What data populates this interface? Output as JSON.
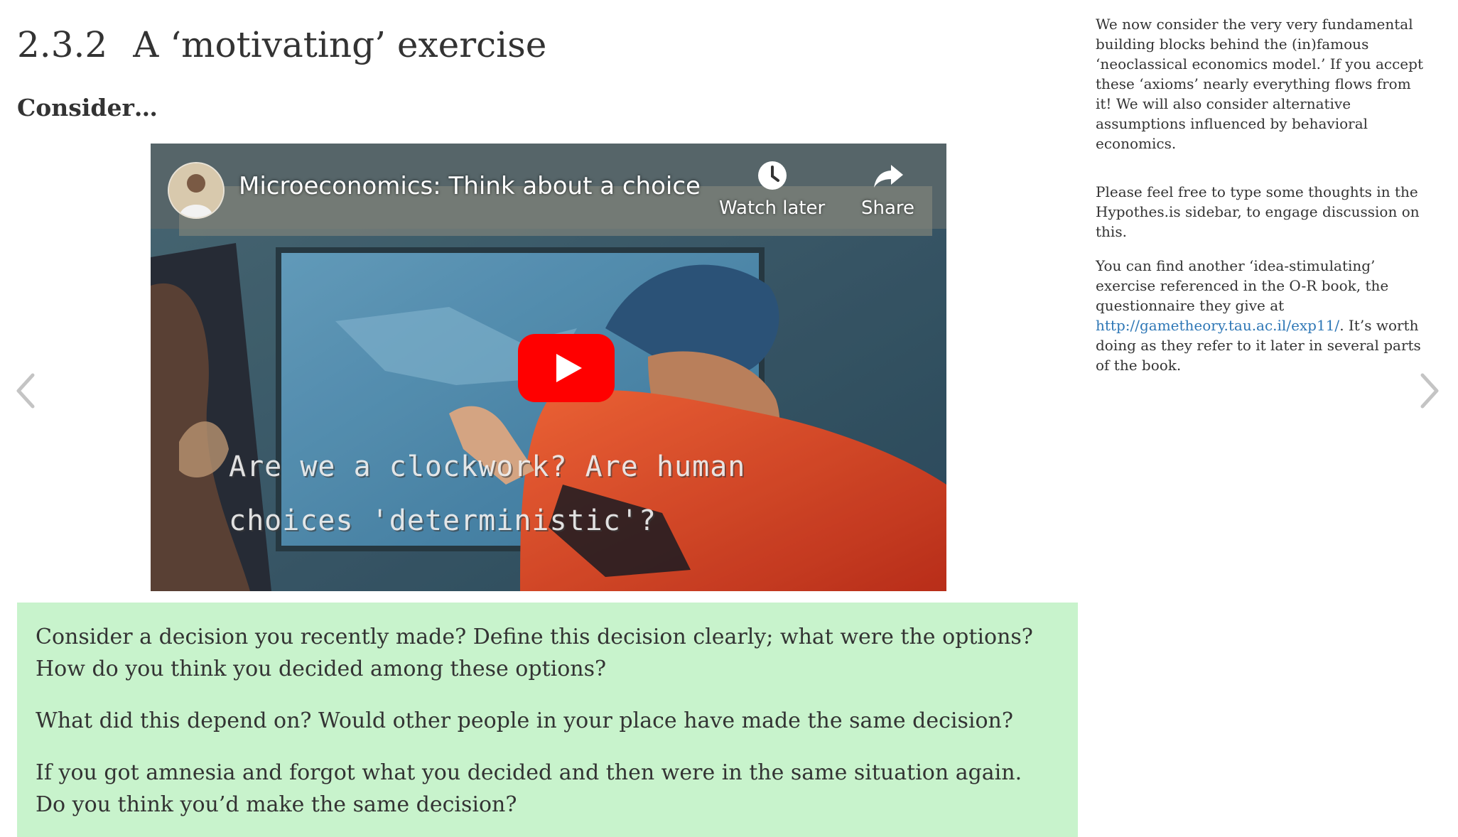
{
  "section": {
    "number": "2.3.2",
    "title": "A ‘motivating’ exercise"
  },
  "consider_heading": "Consider…",
  "video": {
    "title": "Microeconomics: Think about a choice",
    "watch_later_label": "Watch later",
    "share_label": "Share",
    "caption_line1": "Are we a clockwork? Are human",
    "caption_line2": "choices 'deterministic'?"
  },
  "callout": {
    "paragraphs": [
      "Consider a decision you recently made? Define this decision clearly; what were the options? How do you think you decided among these options?",
      "What did this depend on? Would other people in your place have made the same decision?",
      "If you got amnesia and forgot what you decided and then were in the same situation again. Do you think you’d make the same decision?"
    ]
  },
  "sidenote": {
    "p1": "We now consider the very very fundamental building blocks behind the (in)famous ‘neoclassical economics model.’ If you accept these ‘axioms’ nearly everything flows from it! We will also consider alternative assumptions influenced by behavioral economics.",
    "p2": "Please feel free to type some thoughts in the Hypothes.is sidebar, to engage discussion on this.",
    "p3_before": "You can find another ‘idea-stimulating’ exercise referenced in the O-R book, the questionnaire they give at ",
    "p3_link": "http://gametheory.tau.ac.il/exp11/",
    "p3_after": ". It’s worth doing as they refer to it later in several parts of the book."
  },
  "colors": {
    "callout_bg": "#c8f3cc",
    "link": "#2e77b6",
    "play_red": "#ff0000"
  },
  "icons": {
    "prev": "chevron-left-icon",
    "next": "chevron-right-icon",
    "watch_later": "clock-icon",
    "share": "share-arrow-icon",
    "play": "play-icon"
  }
}
